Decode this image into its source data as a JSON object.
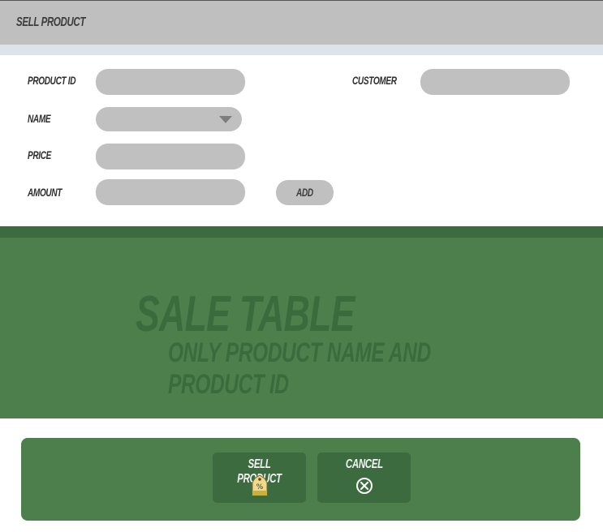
{
  "window": {
    "title": "SELL PRODUCT"
  },
  "form": {
    "product_id": {
      "label": "PRODUCT ID",
      "value": "",
      "placeholder": ""
    },
    "name": {
      "label": "NAME",
      "value": "",
      "placeholder": ""
    },
    "price": {
      "label": "PRICE",
      "value": "",
      "placeholder": ""
    },
    "amount": {
      "label": "AMOUNT",
      "value": "",
      "placeholder": ""
    },
    "customer": {
      "label": "CUSTOMER",
      "value": "",
      "placeholder": ""
    },
    "add_label": "ADD"
  },
  "sale_table": {
    "title": "SALE TABLE",
    "subtitle": "ONLY PRODUCT NAME AND PRODUCT ID"
  },
  "actions": {
    "sell_label": "SELL PRODUCT",
    "sell_icon": "price-tag-icon",
    "cancel_label": "CANCEL",
    "cancel_icon": "cancel-circle-icon"
  },
  "colors": {
    "titlebar": "#bfbfbf",
    "field": "#c0c0c0",
    "green_panel": "#4d7f4d",
    "dark_green": "#3c6b3f"
  }
}
